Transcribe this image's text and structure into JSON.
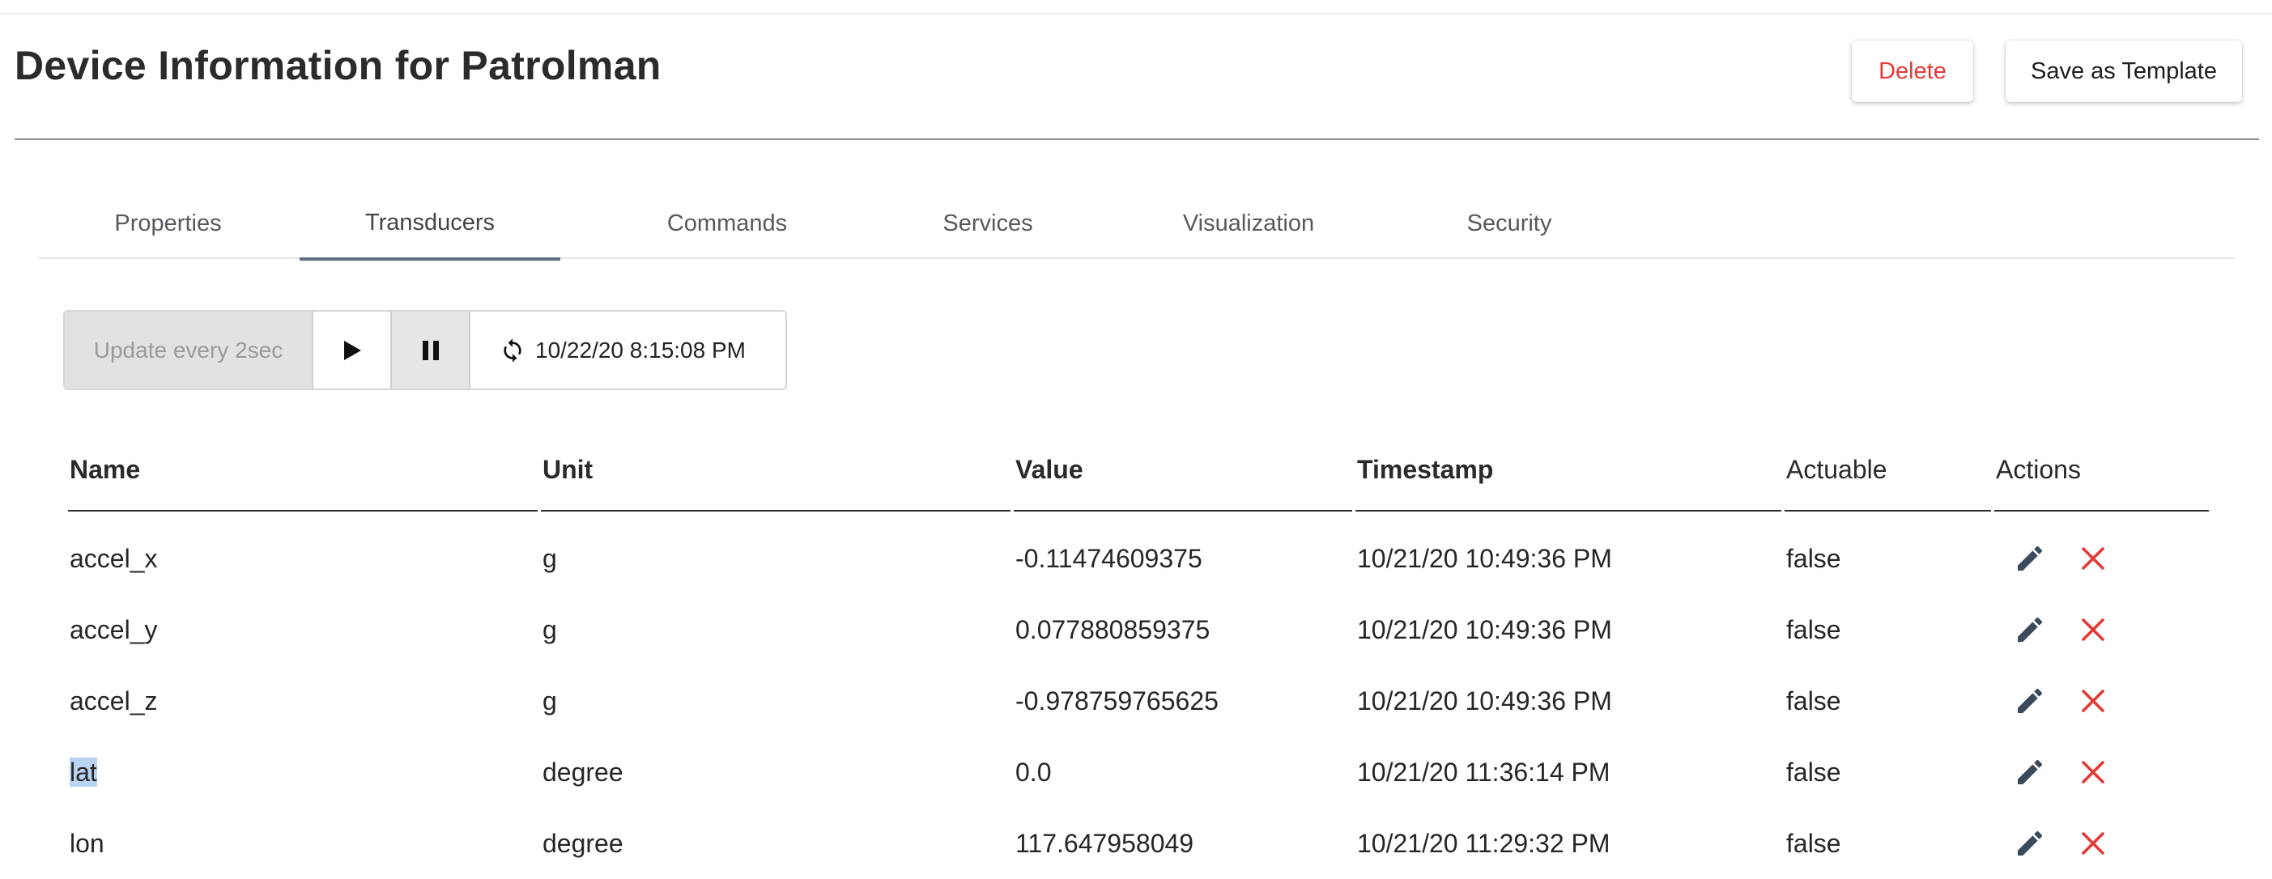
{
  "header": {
    "title": "Device Information for Patrolman",
    "delete_label": "Delete",
    "save_template_label": "Save as Template"
  },
  "tabs": [
    {
      "label": "Properties",
      "active": false
    },
    {
      "label": "Transducers",
      "active": true
    },
    {
      "label": "Commands",
      "active": false
    },
    {
      "label": "Services",
      "active": false
    },
    {
      "label": "Visualization",
      "active": false
    },
    {
      "label": "Security",
      "active": false
    }
  ],
  "refresh": {
    "interval_label": "Update every 2sec",
    "timestamp": "10/22/20 8:15:08 PM"
  },
  "table": {
    "headers": [
      "Name",
      "Unit",
      "Value",
      "Timestamp",
      "Actuable",
      "Actions"
    ],
    "rows": [
      {
        "name": "accel_x",
        "unit": "g",
        "value": "-0.11474609375",
        "timestamp": "10/21/20 10:49:36 PM",
        "actuable": "false"
      },
      {
        "name": "accel_y",
        "unit": "g",
        "value": "0.077880859375",
        "timestamp": "10/21/20 10:49:36 PM",
        "actuable": "false"
      },
      {
        "name": "accel_z",
        "unit": "g",
        "value": "-0.978759765625",
        "timestamp": "10/21/20 10:49:36 PM",
        "actuable": "false"
      },
      {
        "name": "lat",
        "unit": "degree",
        "value": "0.0",
        "timestamp": "10/21/20 11:36:14 PM",
        "actuable": "false"
      },
      {
        "name": "lon",
        "unit": "degree",
        "value": "117.647958049",
        "timestamp": "10/21/20 11:29:32 PM",
        "actuable": "false"
      }
    ]
  },
  "colors": {
    "delete": "#e53935",
    "edit_icon": "#3a4a5c",
    "remove_icon": "#e53935",
    "active_tab_underline": "#5f6e80"
  },
  "icons": {
    "play": "play-icon",
    "pause": "pause-icon",
    "refresh": "refresh-icon",
    "edit": "pencil-icon",
    "remove": "close-icon"
  }
}
